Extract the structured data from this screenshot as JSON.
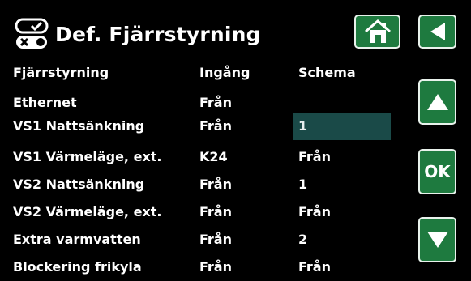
{
  "title": "Def. Fjärrstyrning",
  "columns": [
    "Fjärrstyrning",
    "Ingång",
    "Schema"
  ],
  "rows": [
    {
      "name": "Ethernet",
      "input": "Från",
      "schedule": ""
    },
    {
      "name": "VS1 Nattsänkning",
      "input": "Från",
      "schedule": "1"
    },
    {
      "name": "VS1 Värmeläge, ext.",
      "input": "K24",
      "schedule": "Från"
    },
    {
      "name": "VS2 Nattsänkning",
      "input": "Från",
      "schedule": "1"
    },
    {
      "name": "VS2 Värmeläge, ext.",
      "input": "Från",
      "schedule": "Från"
    },
    {
      "name": "Extra varmvatten",
      "input": "Från",
      "schedule": "2"
    },
    {
      "name": "Blockering frikyla",
      "input": "Från",
      "schedule": "Från"
    }
  ],
  "buttons": {
    "ok": "OK"
  },
  "icons": {
    "title": "switch-toggle-icon",
    "home": "home-icon",
    "back": "back-arrow-icon",
    "up": "up-arrow-icon",
    "down": "down-arrow-icon"
  },
  "colors": {
    "background": "#000000",
    "button": "#1e7a3f",
    "selection": "#1a4a48",
    "text": "#ffffff"
  }
}
